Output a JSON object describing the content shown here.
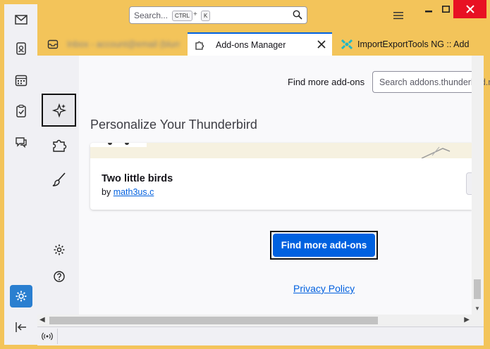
{
  "titlebar": {
    "search_placeholder": "Search...",
    "shortcut_key1": "CTRL",
    "shortcut_plus": "+",
    "shortcut_key2": "K"
  },
  "tabs": [
    {
      "label": "Inbox - account@email (blurred)",
      "active": false
    },
    {
      "label": "Add-ons Manager",
      "active": true
    },
    {
      "label": "ImportExportTools NG :: Add",
      "active": false
    }
  ],
  "addons": {
    "find_more_label": "Find more add-ons",
    "search_placeholder": "Search addons.thunderbird.net",
    "heading": "Personalize Your Thunderbird",
    "card": {
      "name": "Two little birds",
      "by_prefix": "by",
      "author": "math3us.c"
    },
    "find_more_button": "Find more add-ons",
    "privacy_link": "Privacy Policy"
  },
  "colors": {
    "window_border": "#f3c45a",
    "accent": "#0061e0",
    "close_button": "#e81123"
  },
  "icons": {
    "spaces": [
      "mail-icon",
      "address-book-icon",
      "calendar-icon",
      "tasks-icon",
      "chat-icon",
      "settings-icon",
      "collapse-icon"
    ],
    "categories": [
      "recommendations-icon",
      "extensions-icon",
      "themes-icon"
    ],
    "utility": [
      "gear-icon",
      "help-icon"
    ]
  }
}
